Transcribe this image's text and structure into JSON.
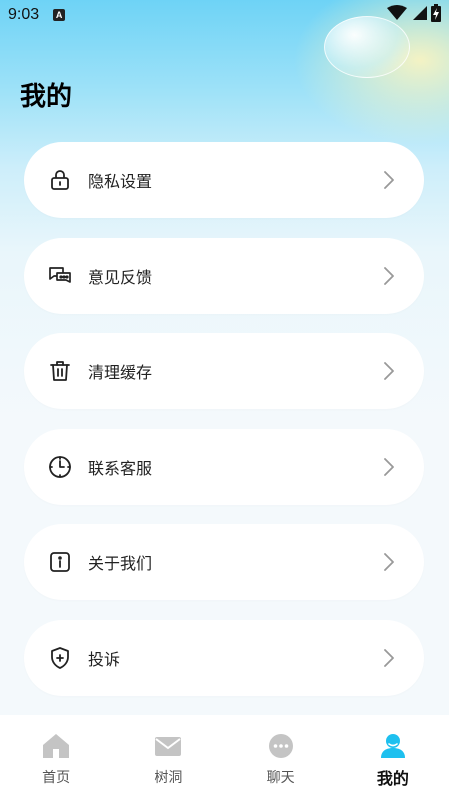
{
  "status": {
    "time": "9:03",
    "badge": "A",
    "icons": [
      "wifi-icon",
      "signal-icon",
      "battery-charging-icon"
    ]
  },
  "page": {
    "title": "我的"
  },
  "menu": {
    "items": [
      {
        "label": "隐私设置",
        "icon": "lock-icon"
      },
      {
        "label": "意见反馈",
        "icon": "chat-bubbles-icon"
      },
      {
        "label": "清理缓存",
        "icon": "trash-icon"
      },
      {
        "label": "联系客服",
        "icon": "clock-icon"
      },
      {
        "label": "关于我们",
        "icon": "info-icon"
      },
      {
        "label": "投诉",
        "icon": "shield-icon"
      }
    ]
  },
  "tabbar": {
    "tabs": [
      {
        "label": "首页",
        "icon": "home-icon",
        "active": false
      },
      {
        "label": "树洞",
        "icon": "mail-icon",
        "active": false
      },
      {
        "label": "聊天",
        "icon": "chat-dots-icon",
        "active": false
      },
      {
        "label": "我的",
        "icon": "user-icon",
        "active": true
      }
    ]
  },
  "colors": {
    "accent": "#1ec0ef",
    "inactive_icon": "#c4c4c4",
    "card": "#ffffff"
  }
}
